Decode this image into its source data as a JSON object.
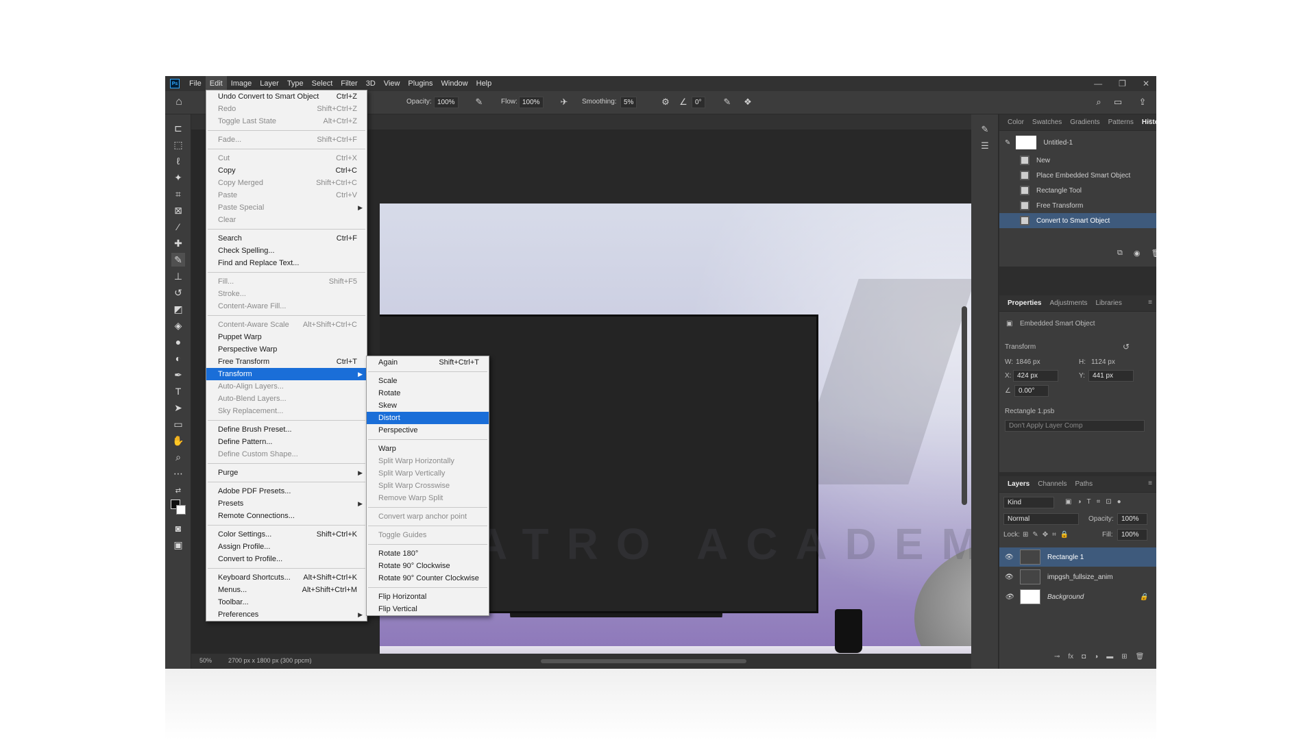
{
  "menubar": {
    "logo": "Ps",
    "items": [
      "File",
      "Edit",
      "Image",
      "Layer",
      "Type",
      "Select",
      "Filter",
      "3D",
      "View",
      "Plugins",
      "Window",
      "Help"
    ],
    "active_index": 1
  },
  "options_bar": {
    "opacity_label": "Opacity:",
    "opacity_value": "100%",
    "flow_label": "Flow:",
    "flow_value": "100%",
    "smoothing_label": "Smoothing:",
    "smoothing_value": "5%",
    "angle_value": "0°"
  },
  "edit_menu": {
    "items": [
      {
        "label": "Undo Convert to Smart Object",
        "shortcut": "Ctrl+Z",
        "disabled": false
      },
      {
        "label": "Redo",
        "shortcut": "Shift+Ctrl+Z",
        "disabled": true
      },
      {
        "label": "Toggle Last State",
        "shortcut": "Alt+Ctrl+Z",
        "disabled": true
      },
      {
        "sep": true
      },
      {
        "label": "Fade...",
        "shortcut": "Shift+Ctrl+F",
        "disabled": true
      },
      {
        "sep": true
      },
      {
        "label": "Cut",
        "shortcut": "Ctrl+X",
        "disabled": true
      },
      {
        "label": "Copy",
        "shortcut": "Ctrl+C",
        "disabled": false
      },
      {
        "label": "Copy Merged",
        "shortcut": "Shift+Ctrl+C",
        "disabled": true
      },
      {
        "label": "Paste",
        "shortcut": "Ctrl+V",
        "disabled": true
      },
      {
        "label": "Paste Special",
        "shortcut": "",
        "disabled": true,
        "submenu": true
      },
      {
        "label": "Clear",
        "shortcut": "",
        "disabled": true
      },
      {
        "sep": true
      },
      {
        "label": "Search",
        "shortcut": "Ctrl+F",
        "disabled": false
      },
      {
        "label": "Check Spelling...",
        "shortcut": "",
        "disabled": false
      },
      {
        "label": "Find and Replace Text...",
        "shortcut": "",
        "disabled": false
      },
      {
        "sep": true
      },
      {
        "label": "Fill...",
        "shortcut": "Shift+F5",
        "disabled": true
      },
      {
        "label": "Stroke...",
        "shortcut": "",
        "disabled": true
      },
      {
        "label": "Content-Aware Fill...",
        "shortcut": "",
        "disabled": true
      },
      {
        "sep": true
      },
      {
        "label": "Content-Aware Scale",
        "shortcut": "Alt+Shift+Ctrl+C",
        "disabled": true
      },
      {
        "label": "Puppet Warp",
        "shortcut": "",
        "disabled": false
      },
      {
        "label": "Perspective Warp",
        "shortcut": "",
        "disabled": false
      },
      {
        "label": "Free Transform",
        "shortcut": "Ctrl+T",
        "disabled": false
      },
      {
        "label": "Transform",
        "shortcut": "",
        "disabled": false,
        "submenu": true,
        "highlight": true
      },
      {
        "label": "Auto-Align Layers...",
        "shortcut": "",
        "disabled": true
      },
      {
        "label": "Auto-Blend Layers...",
        "shortcut": "",
        "disabled": true
      },
      {
        "label": "Sky Replacement...",
        "shortcut": "",
        "disabled": true
      },
      {
        "sep": true
      },
      {
        "label": "Define Brush Preset...",
        "shortcut": "",
        "disabled": false
      },
      {
        "label": "Define Pattern...",
        "shortcut": "",
        "disabled": false
      },
      {
        "label": "Define Custom Shape...",
        "shortcut": "",
        "disabled": true
      },
      {
        "sep": true
      },
      {
        "label": "Purge",
        "shortcut": "",
        "disabled": false,
        "submenu": true
      },
      {
        "sep": true
      },
      {
        "label": "Adobe PDF Presets...",
        "shortcut": "",
        "disabled": false
      },
      {
        "label": "Presets",
        "shortcut": "",
        "disabled": false,
        "submenu": true
      },
      {
        "label": "Remote Connections...",
        "shortcut": "",
        "disabled": false
      },
      {
        "sep": true
      },
      {
        "label": "Color Settings...",
        "shortcut": "Shift+Ctrl+K",
        "disabled": false
      },
      {
        "label": "Assign Profile...",
        "shortcut": "",
        "disabled": false
      },
      {
        "label": "Convert to Profile...",
        "shortcut": "",
        "disabled": false
      },
      {
        "sep": true
      },
      {
        "label": "Keyboard Shortcuts...",
        "shortcut": "Alt+Shift+Ctrl+K",
        "disabled": false
      },
      {
        "label": "Menus...",
        "shortcut": "Alt+Shift+Ctrl+M",
        "disabled": false
      },
      {
        "label": "Toolbar...",
        "shortcut": "",
        "disabled": false
      },
      {
        "label": "Preferences",
        "shortcut": "",
        "disabled": false,
        "submenu": true
      }
    ]
  },
  "transform_menu": {
    "items": [
      {
        "label": "Again",
        "shortcut": "Shift+Ctrl+T",
        "disabled": false
      },
      {
        "sep": true
      },
      {
        "label": "Scale",
        "shortcut": "",
        "disabled": false
      },
      {
        "label": "Rotate",
        "shortcut": "",
        "disabled": false
      },
      {
        "label": "Skew",
        "shortcut": "",
        "disabled": false
      },
      {
        "label": "Distort",
        "shortcut": "",
        "disabled": false,
        "highlight": true
      },
      {
        "label": "Perspective",
        "shortcut": "",
        "disabled": false
      },
      {
        "sep": true
      },
      {
        "label": "Warp",
        "shortcut": "",
        "disabled": false
      },
      {
        "label": "Split Warp Horizontally",
        "shortcut": "",
        "disabled": true
      },
      {
        "label": "Split Warp Vertically",
        "shortcut": "",
        "disabled": true
      },
      {
        "label": "Split Warp Crosswise",
        "shortcut": "",
        "disabled": true
      },
      {
        "label": "Remove Warp Split",
        "shortcut": "",
        "disabled": true
      },
      {
        "sep": true
      },
      {
        "label": "Convert warp anchor point",
        "shortcut": "",
        "disabled": true
      },
      {
        "sep": true
      },
      {
        "label": "Toggle Guides",
        "shortcut": "",
        "disabled": true
      },
      {
        "sep": true
      },
      {
        "label": "Rotate 180°",
        "shortcut": "",
        "disabled": false
      },
      {
        "label": "Rotate 90° Clockwise",
        "shortcut": "",
        "disabled": false
      },
      {
        "label": "Rotate 90° Counter Clockwise",
        "shortcut": "",
        "disabled": false
      },
      {
        "sep": true
      },
      {
        "label": "Flip Horizontal",
        "shortcut": "",
        "disabled": false
      },
      {
        "label": "Flip Vertical",
        "shortcut": "",
        "disabled": false
      }
    ]
  },
  "canvas": {
    "watermark": "ATRO ACADEMY"
  },
  "status_bar": {
    "zoom": "50%",
    "info": "2700 px x 1800 px (300 ppcm)"
  },
  "history_panel": {
    "tabs": [
      "Color",
      "Swatches",
      "Gradients",
      "Patterns",
      "History"
    ],
    "active_tab": "History",
    "snapshot": "Untitled-1",
    "states": [
      "New",
      "Place Embedded Smart Object",
      "Rectangle Tool",
      "Free Transform",
      "Convert to Smart Object"
    ],
    "active_state": 4
  },
  "properties_panel": {
    "tabs": [
      "Properties",
      "Adjustments",
      "Libraries"
    ],
    "active_tab": "Properties",
    "object_type": "Embedded Smart Object",
    "section": "Transform",
    "w_label": "W:",
    "w_value": "1846 px",
    "h_label": "H:",
    "h_value": "1124 px",
    "x_label": "X:",
    "x_value": "424 px",
    "y_label": "Y:",
    "y_value": "441 px",
    "angle_value": "0.00°",
    "file_name": "Rectangle 1.psb",
    "layer_comp": "Don't Apply Layer Comp"
  },
  "layers_panel": {
    "tabs": [
      "Layers",
      "Channels",
      "Paths"
    ],
    "active_tab": "Layers",
    "filter_kind": "Kind",
    "blend_mode": "Normal",
    "opacity_label": "Opacity:",
    "opacity_value": "100%",
    "lock_label": "Lock:",
    "fill_label": "Fill:",
    "fill_value": "100%",
    "layers": [
      {
        "name": "Rectangle 1",
        "active": true
      },
      {
        "name": "impgsh_fullsize_anim",
        "active": false
      },
      {
        "name": "Background",
        "active": false,
        "locked": true
      }
    ]
  }
}
